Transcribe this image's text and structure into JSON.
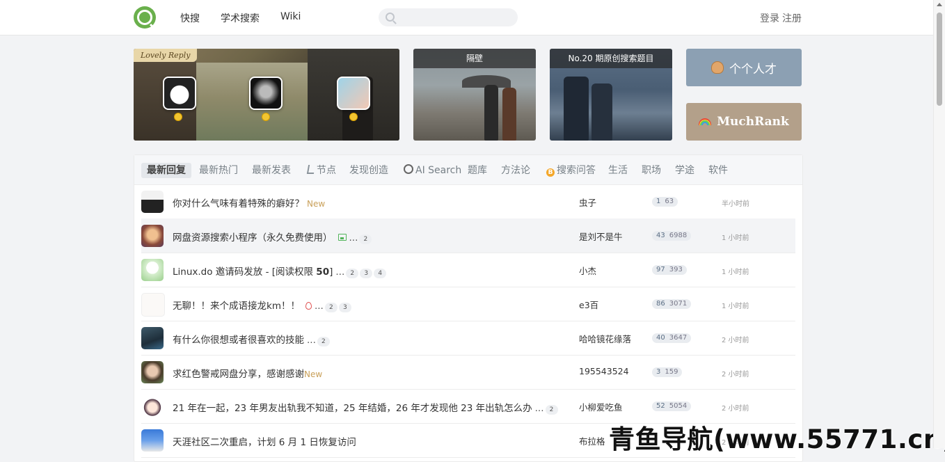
{
  "nav": {
    "links": [
      "快搜",
      "学术搜索",
      "Wiki"
    ],
    "search_placeholder": "",
    "login": "登录",
    "register": "注册"
  },
  "banners": {
    "lovely_reply": "Lovely Reply",
    "neighbor": "隔壁",
    "contest": "No.20 期原创搜索题目",
    "talent": "个个人才",
    "rank": "MuchRank"
  },
  "tabs": [
    "最新回复",
    "最新热门",
    "最新发表",
    "节点",
    "发现创造",
    "AI Search",
    "题库",
    "方法论",
    "搜索问答",
    "生活",
    "职场",
    "学途",
    "软件"
  ],
  "topics": [
    {
      "title": "你对什么气味有着特殊的癖好？",
      "new": "New",
      "pages": [],
      "author": "虫子",
      "replies": "1",
      "views": "63",
      "time": "半小时前"
    },
    {
      "title": "网盘资源搜索小程序（永久免费使用）",
      "pages": [
        "2"
      ],
      "author": "是刘不是牛",
      "replies": "43",
      "views": "6988",
      "time": "1 小时前"
    },
    {
      "title": "Linux.do 邀请码发放 - [阅读权限 ",
      "bold": "50",
      "title_tail": "]",
      "pages": [
        "2",
        "3",
        "4"
      ],
      "author": "小杰",
      "replies": "97",
      "views": "393",
      "time": "1 小时前"
    },
    {
      "title": "无聊！！来个成语接龙km！！",
      "pages": [
        "2",
        "3"
      ],
      "author": "e3百",
      "replies": "86",
      "views": "3071",
      "time": "1 小时前"
    },
    {
      "title": "有什么你很想或者很喜欢的技能",
      "pages": [
        "2"
      ],
      "author": "哈哈镜花缘落",
      "replies": "40",
      "views": "3647",
      "time": "2 小时前"
    },
    {
      "title": "求红色警戒网盘分享，感谢感谢",
      "new": "New",
      "pages": [],
      "author": "195543524",
      "replies": "3",
      "views": "159",
      "time": "2 小时前"
    },
    {
      "title": "21 年在一起，23 年男友出轨我不知道，25 年结婚，26 年才发现他 23 年出轨怎么办",
      "pages": [
        "2"
      ],
      "author": "小柳爱吃鱼",
      "replies": "52",
      "views": "5054",
      "time": "2 小时前"
    },
    {
      "title": "天涯社区二次重启，计划 6 月 1 日恢复访问",
      "pages": [],
      "author": "布拉格",
      "replies": "",
      "views": "",
      "time": "2 小时前"
    }
  ],
  "ellipsis": "...",
  "watermark": "青鱼导航(www.55771.cn)",
  "colors": {
    "accent": "#6ab04c",
    "new_tag": "#c9a05a",
    "talent_btn": "#8ca0b3",
    "rank_btn": "#b3a08a"
  }
}
